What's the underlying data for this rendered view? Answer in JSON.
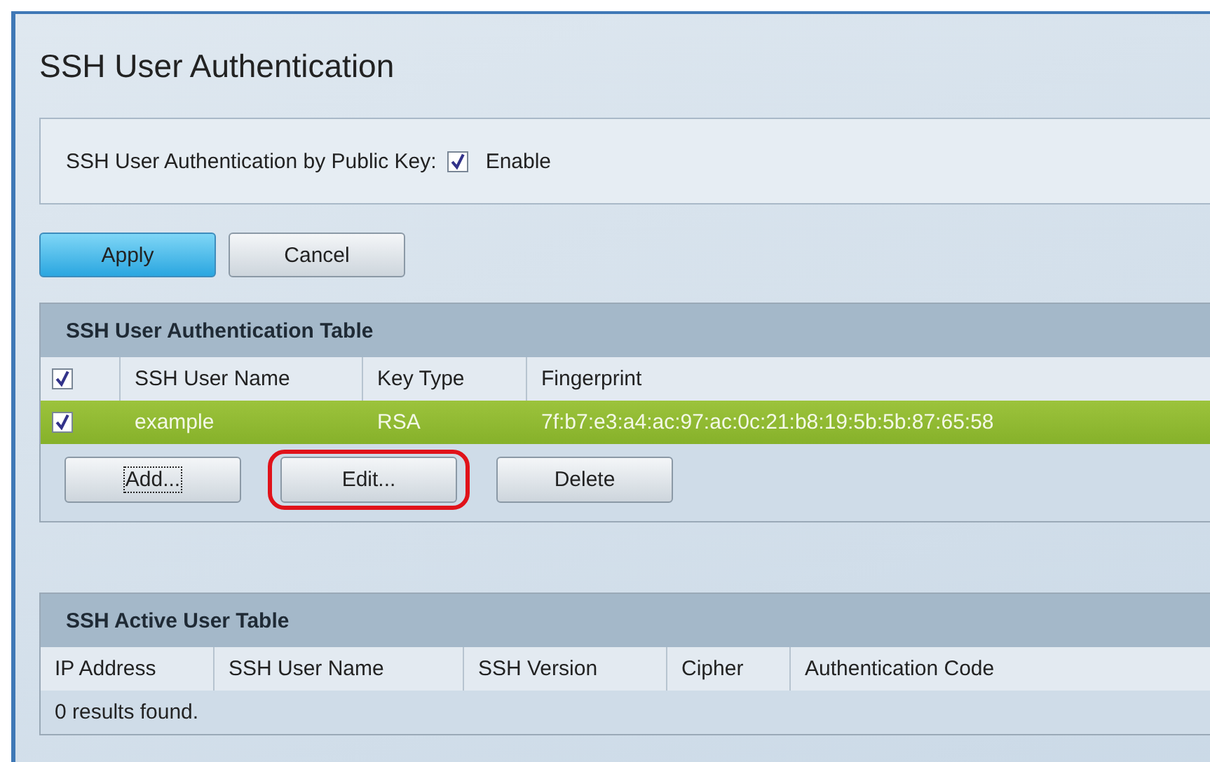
{
  "page": {
    "title": "SSH User Authentication"
  },
  "setting": {
    "label": "SSH User Authentication by Public Key:",
    "checked": true,
    "option": "Enable"
  },
  "form_buttons": [
    {
      "label": "Apply",
      "primary": true
    },
    {
      "label": "Cancel",
      "primary": false
    }
  ],
  "user_table": {
    "title": "SSH User Authentication Table",
    "select_all": true,
    "columns": [
      "SSH User Name",
      "Key Type",
      "Fingerprint"
    ],
    "rows": [
      {
        "cells": [
          "example",
          "RSA",
          "7f:b7:e3:a4:ac:97:ac:0c:21:b8:19:5b:5b:87:65:58"
        ],
        "checked": true,
        "selected": true
      }
    ],
    "buttons": [
      {
        "label": "Add...",
        "focused": true,
        "highlighted": false
      },
      {
        "label": "Edit...",
        "focused": false,
        "highlighted": true
      },
      {
        "label": "Delete",
        "focused": false,
        "highlighted": false
      }
    ]
  },
  "active_table": {
    "title": "SSH Active User Table",
    "columns": [
      "IP Address",
      "SSH User Name",
      "SSH Version",
      "Cipher",
      "Authentication Code"
    ],
    "empty_text": "0 results found."
  }
}
